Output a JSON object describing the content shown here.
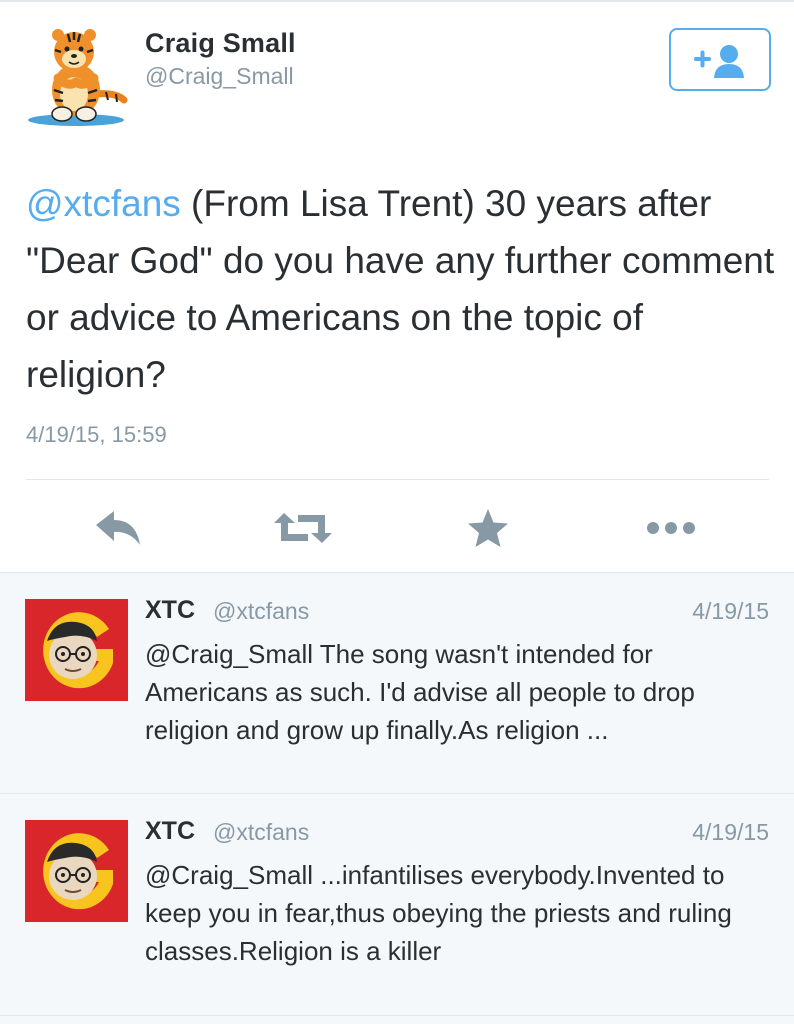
{
  "colors": {
    "link": "#55acee",
    "text": "#292f33",
    "muted": "#8899a6",
    "icon": "#8899a6"
  },
  "main_tweet": {
    "author_name": "Craig Small",
    "author_handle": "@Craig_Small",
    "mention": "@xtcfans",
    "text": " (From Lisa Trent) 30 years after \"Dear God\" do you have any further comment or advice to Americans on the topic of religion?",
    "timestamp": "4/19/15, 15:59",
    "follow_icon": "follow-plus-user-icon"
  },
  "actions": [
    {
      "name": "reply",
      "icon": "reply-icon"
    },
    {
      "name": "retweet",
      "icon": "retweet-icon"
    },
    {
      "name": "favorite",
      "icon": "star-icon"
    },
    {
      "name": "more",
      "icon": "more-dots-icon"
    }
  ],
  "replies": [
    {
      "author_name": "XTC",
      "author_handle": "@xtcfans",
      "date": "4/19/15",
      "text": "@Craig_Small The song wasn't intended for Americans as such. I'd advise all people to drop religion and grow up finally.As religion ..."
    },
    {
      "author_name": "XTC",
      "author_handle": "@xtcfans",
      "date": "4/19/15",
      "text": "@Craig_Small ...infantilises everybody.Invented to keep you in fear,thus obeying the priests and ruling classes.Religion is a killer"
    }
  ]
}
